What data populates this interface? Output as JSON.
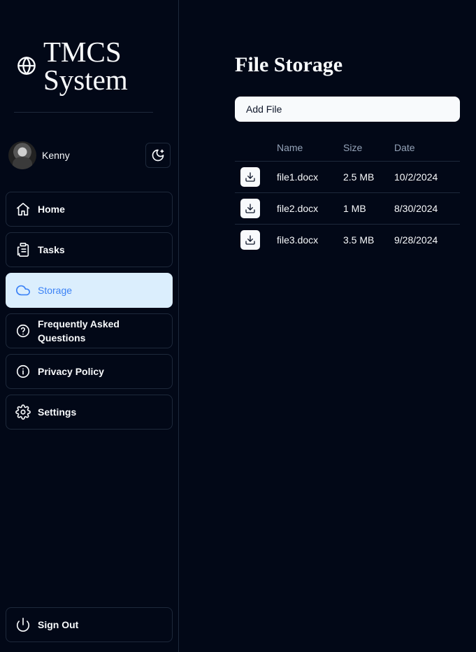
{
  "brand": {
    "title": "TMCS System"
  },
  "user": {
    "name": "Kenny"
  },
  "nav": {
    "items": [
      {
        "label": "Home",
        "icon": "home-icon",
        "active": false
      },
      {
        "label": "Tasks",
        "icon": "clipboard-icon",
        "active": false
      },
      {
        "label": "Storage",
        "icon": "cloud-icon",
        "active": true
      },
      {
        "label": "Frequently Asked Questions",
        "icon": "help-circle-icon",
        "active": false
      },
      {
        "label": "Privacy Policy",
        "icon": "info-icon",
        "active": false
      },
      {
        "label": "Settings",
        "icon": "gear-icon",
        "active": false
      }
    ],
    "sign_out": "Sign Out"
  },
  "main": {
    "title": "File Storage",
    "add_file_label": "Add File",
    "table": {
      "headers": {
        "name": "Name",
        "size": "Size",
        "date": "Date"
      },
      "rows": [
        {
          "name": "file1.docx",
          "size": "2.5 MB",
          "date": "10/2/2024"
        },
        {
          "name": "file2.docx",
          "size": "1 MB",
          "date": "8/30/2024"
        },
        {
          "name": "file3.docx",
          "size": "3.5 MB",
          "date": "9/28/2024"
        }
      ]
    }
  },
  "colors": {
    "background": "#020817",
    "border": "#1e293b",
    "active_bg": "#dbeefd",
    "active_text": "#3b82f6",
    "muted_text": "#94a3b8"
  }
}
